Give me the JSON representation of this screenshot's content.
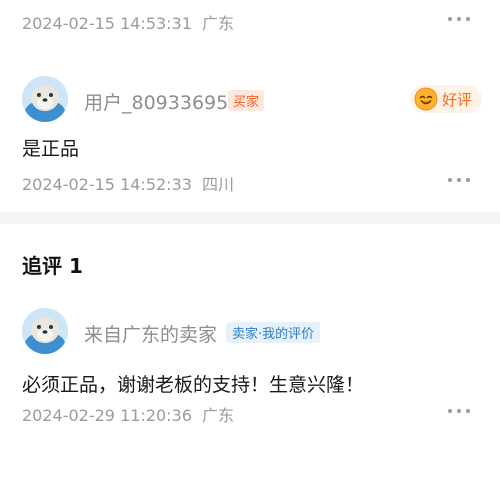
{
  "review_prev": {
    "date": "2024-02-15 14:53:31",
    "location": "广东"
  },
  "review_main": {
    "username": "用户_80933695",
    "role_badge": "买家",
    "rating_label": "好评",
    "content": "是正品",
    "date": "2024-02-15 14:52:33",
    "location": "四川"
  },
  "followup": {
    "title": "追评",
    "count": "1",
    "username": "来自广东的卖家",
    "role_badge": "卖家·我的评价",
    "content": "必须正品，谢谢老板的支持！生意兴隆！",
    "date": "2024-02-29 11:20:36",
    "location": "广东"
  },
  "icons": {
    "more": "more-dots-icon",
    "avatar": "seal-avatar-icon",
    "rating": "smile-emoji-icon"
  },
  "colors": {
    "buyer_badge": "#ff5a1f",
    "seller_badge": "#2f7cc9",
    "rating_text": "#ff6a1a",
    "meta_text": "#9b9b9b"
  }
}
